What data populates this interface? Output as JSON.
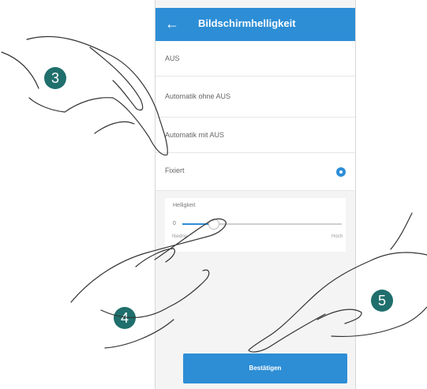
{
  "app_bar": {
    "title": "Bildschirmhelligkeit",
    "back_icon": "back-arrow-icon"
  },
  "options": [
    {
      "label": "AUS",
      "selected": false
    },
    {
      "label": "Automatik ohne AUS",
      "selected": false
    },
    {
      "label": "Automatik mit AUS",
      "selected": false
    },
    {
      "label": "Fixiert",
      "selected": true
    }
  ],
  "brightness": {
    "title": "Helligkeit",
    "marker": "0",
    "min_label": "Niedrig",
    "max_label": "Hoch",
    "level": 0.2
  },
  "confirm_button": {
    "label": "Bestätigen"
  },
  "steps": [
    "3",
    "4",
    "5"
  ],
  "colors": {
    "accent": "#2d8ed6",
    "step_badge": "#1f6f6d"
  }
}
